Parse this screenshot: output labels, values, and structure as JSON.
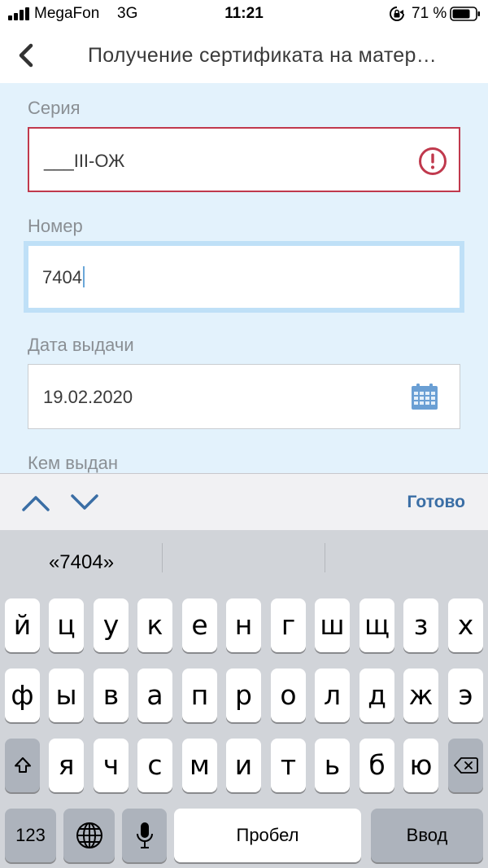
{
  "status_bar": {
    "carrier": "MegaFon",
    "network": "3G",
    "time": "11:21",
    "battery": "71 %"
  },
  "nav": {
    "title": "Получение сертификата на матер…"
  },
  "form": {
    "series": {
      "label": "Серия",
      "value": "___III-ОЖ",
      "state": "error"
    },
    "number": {
      "label": "Номер",
      "value": "7404",
      "state": "focused"
    },
    "issue_date": {
      "label": "Дата выдачи",
      "value": "19.02.2020"
    },
    "issued_by": {
      "label": "Кем выдан"
    }
  },
  "accessory": {
    "done": "Готово"
  },
  "keyboard": {
    "suggestions": [
      "«7404»",
      "",
      ""
    ],
    "row1": [
      "й",
      "ц",
      "у",
      "к",
      "е",
      "н",
      "г",
      "ш",
      "щ",
      "з",
      "х"
    ],
    "row2": [
      "ф",
      "ы",
      "в",
      "а",
      "п",
      "р",
      "о",
      "л",
      "д",
      "ж",
      "э"
    ],
    "row3": [
      "я",
      "ч",
      "с",
      "м",
      "и",
      "т",
      "ь",
      "б",
      "ю"
    ],
    "numbers_key": "123",
    "space_key": "Пробел",
    "return_key": "Ввод"
  },
  "colors": {
    "form_bg": "#e3f2fc",
    "error": "#c0394d",
    "focus_ring": "#bfe0f7",
    "accent": "#3a6ea5",
    "calendar_icon": "#6a9fd4"
  }
}
